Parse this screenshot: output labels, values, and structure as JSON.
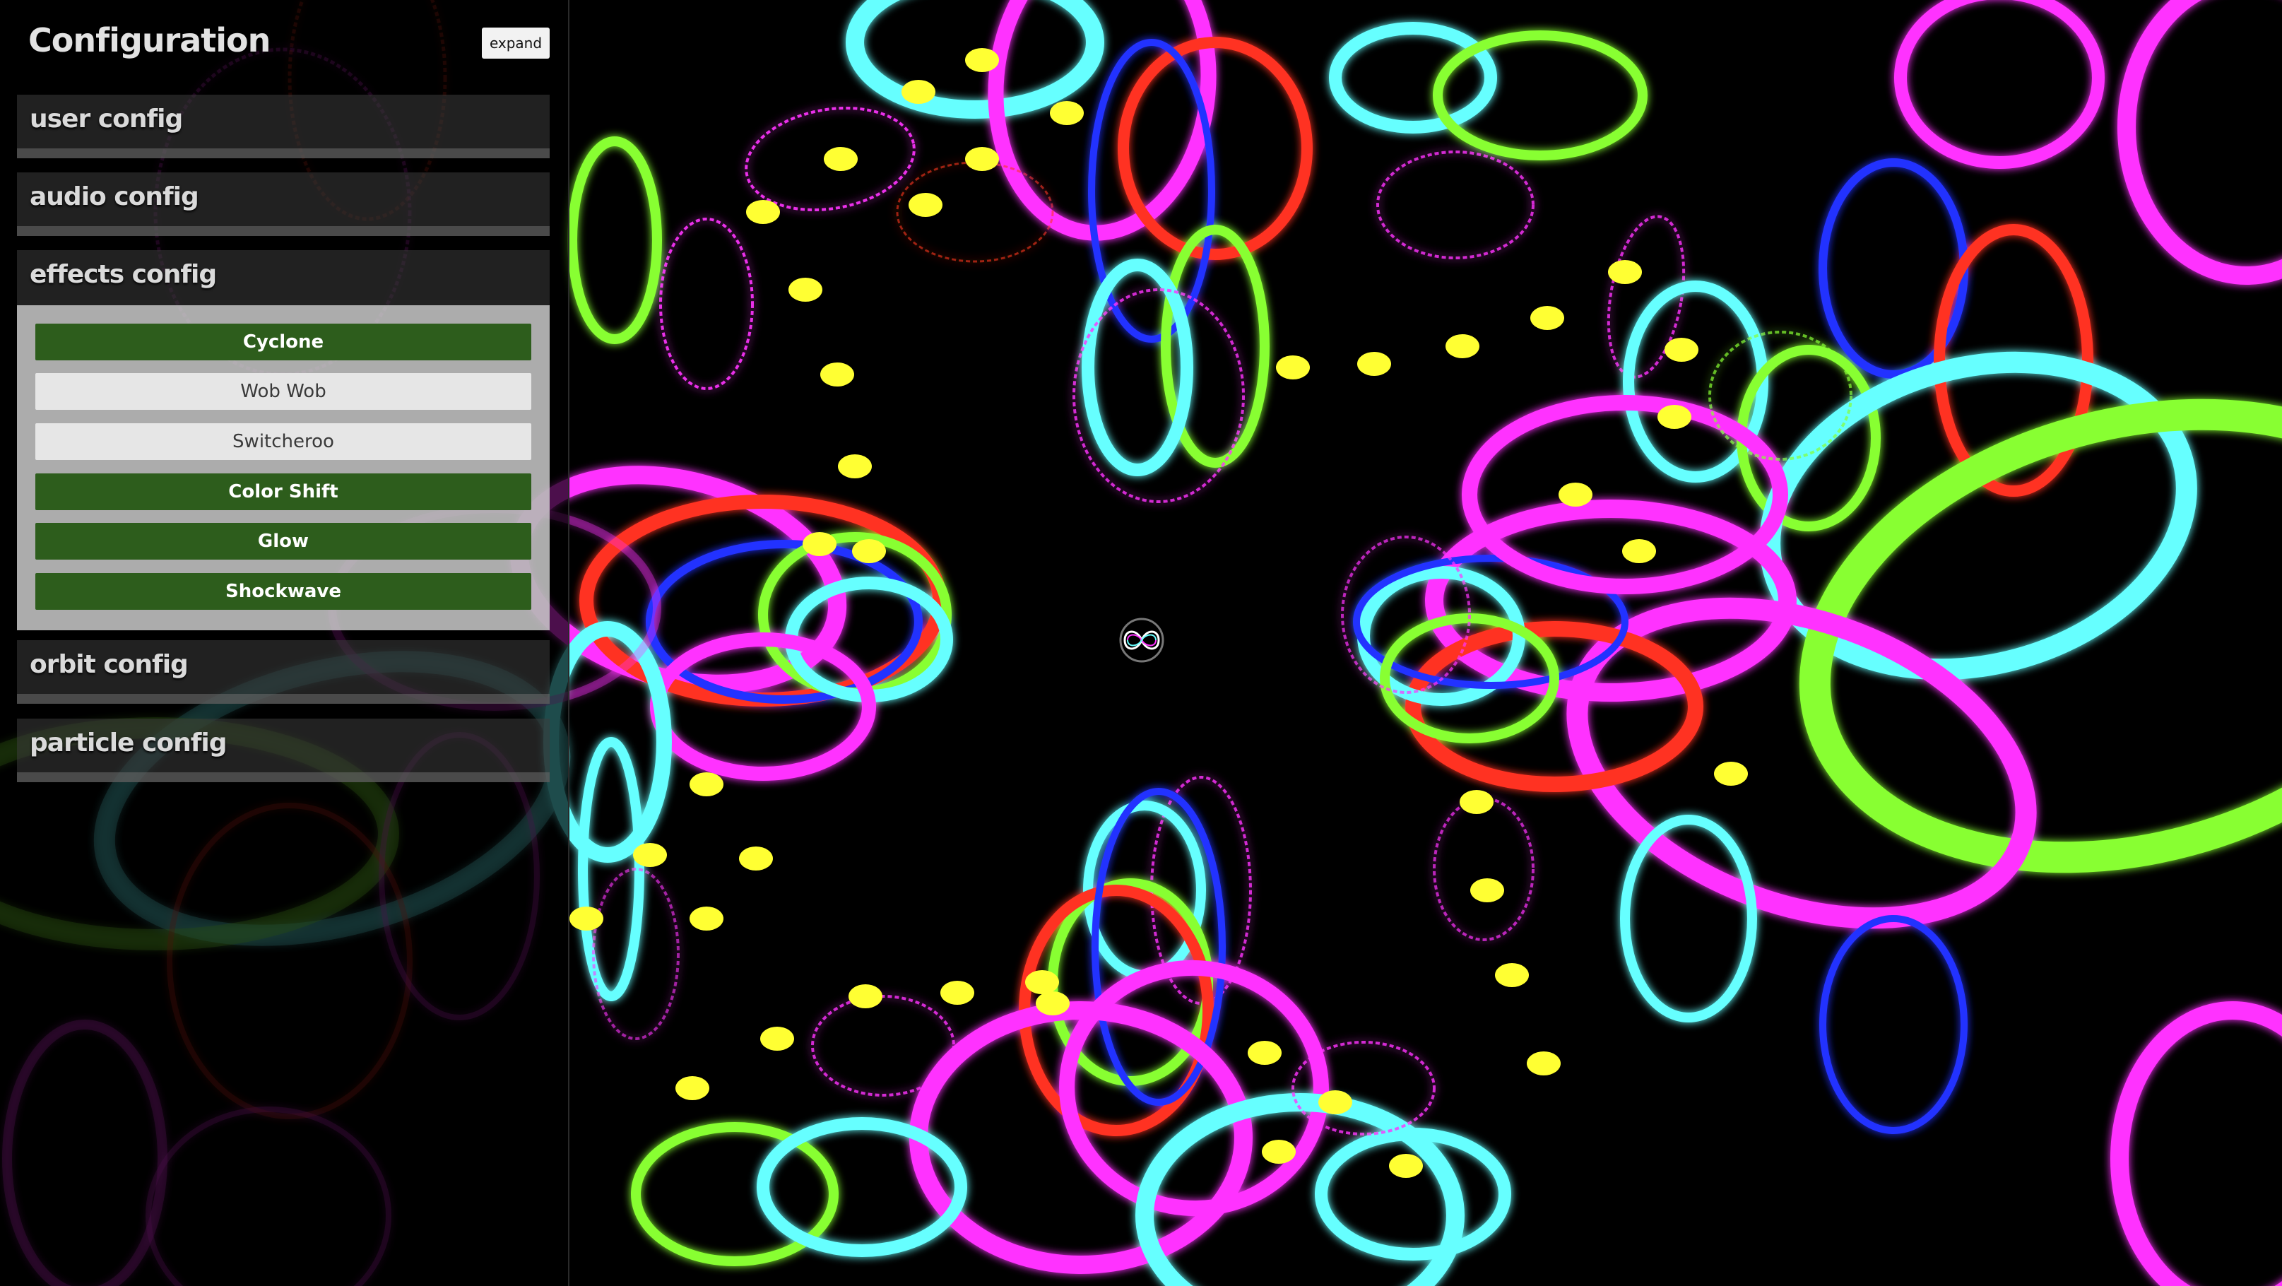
{
  "panel": {
    "title": "Configuration",
    "expand_label": "expand"
  },
  "sections": [
    {
      "label": "user config",
      "expanded": false
    },
    {
      "label": "audio config",
      "expanded": false
    },
    {
      "label": "effects config",
      "expanded": true
    },
    {
      "label": "orbit config",
      "expanded": false
    },
    {
      "label": "particle config",
      "expanded": false
    }
  ],
  "effects": [
    {
      "label": "Cyclone",
      "active": true
    },
    {
      "label": "Wob Wob",
      "active": false
    },
    {
      "label": "Switcheroo",
      "active": false
    },
    {
      "label": "Color Shift",
      "active": true
    },
    {
      "label": "Glow",
      "active": true
    },
    {
      "label": "Shockwave",
      "active": true
    }
  ],
  "colors": {
    "active_button": "#2d5d1c",
    "inactive_button": "#e6e6e6",
    "orbit_magenta": "#ff33ff",
    "orbit_cyan": "#66ffff",
    "orbit_green": "#88ff33",
    "orbit_red": "#ff3322",
    "orbit_blue": "#2233ff",
    "particle_yellow": "#ffff33"
  },
  "visualizer": {
    "center_icon": "infinity-knot-icon"
  }
}
